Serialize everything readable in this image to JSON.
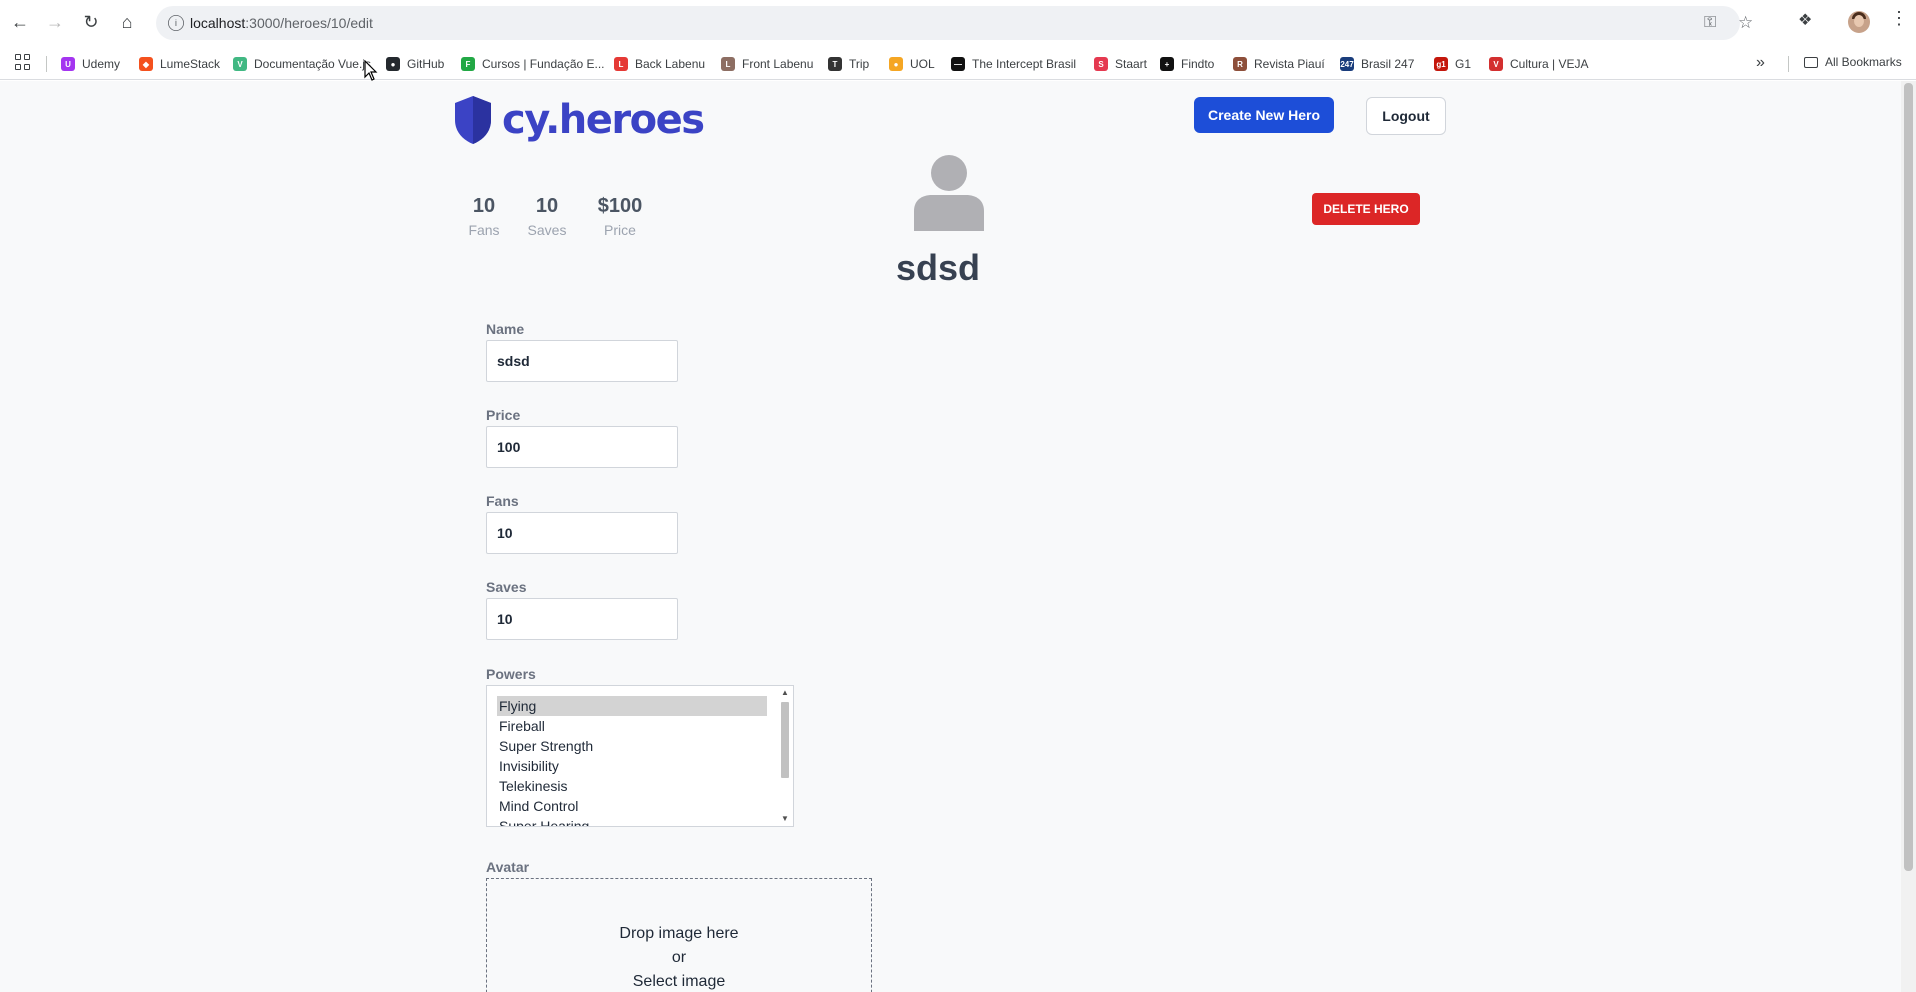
{
  "browser": {
    "url_host": "localhost",
    "url_path": ":3000/heroes/10/edit",
    "bookmarks": [
      {
        "label": "Udemy",
        "color": "#a435f0",
        "glyph": "U"
      },
      {
        "label": "LumeStack",
        "color": "#f4511e",
        "glyph": "◆"
      },
      {
        "label": "Documentação Vue.js",
        "color": "#41b883",
        "glyph": "V"
      },
      {
        "label": "GitHub",
        "color": "#24292e",
        "glyph": "●"
      },
      {
        "label": "Cursos | Fundação E...",
        "color": "#22a845",
        "glyph": "F"
      },
      {
        "label": "Back Labenu",
        "color": "#e53935",
        "glyph": "L"
      },
      {
        "label": "Front Labenu",
        "color": "#8d6e63",
        "glyph": "L"
      },
      {
        "label": "Trip",
        "color": "#333333",
        "glyph": "T"
      },
      {
        "label": "UOL",
        "color": "#f5a623",
        "glyph": "●"
      },
      {
        "label": "The Intercept Brasil",
        "color": "#111111",
        "glyph": "—"
      },
      {
        "label": "Staart",
        "color": "#e53950",
        "glyph": "S"
      },
      {
        "label": "Findto",
        "color": "#111111",
        "glyph": "+"
      },
      {
        "label": "Revista Piauí",
        "color": "#8d4f3a",
        "glyph": "R"
      },
      {
        "label": "Brasil 247",
        "color": "#1a3d7c",
        "glyph": "247"
      },
      {
        "label": "G1",
        "color": "#c4170c",
        "glyph": "g1"
      },
      {
        "label": "Cultura | VEJA",
        "color": "#d32f2f",
        "glyph": "V"
      }
    ],
    "all_bookmarks_label": "All Bookmarks"
  },
  "header": {
    "logo_text": "cy.heroes",
    "create_button": "Create New Hero",
    "logout_button": "Logout"
  },
  "hero": {
    "name": "sdsd",
    "stats": [
      {
        "value": "10",
        "label": "Fans"
      },
      {
        "value": "10",
        "label": "Saves"
      },
      {
        "value": "$100",
        "label": "Price"
      }
    ],
    "delete_button": "DELETE HERO"
  },
  "form": {
    "name": {
      "label": "Name",
      "value": "sdsd"
    },
    "price": {
      "label": "Price",
      "value": "100"
    },
    "fans": {
      "label": "Fans",
      "value": "10"
    },
    "saves": {
      "label": "Saves",
      "value": "10"
    },
    "powers": {
      "label": "Powers",
      "options": [
        "Flying",
        "Fireball",
        "Super Strength",
        "Invisibility",
        "Telekinesis",
        "Mind Control",
        "Super Hearing"
      ],
      "selected": "Flying"
    },
    "avatar": {
      "label": "Avatar",
      "drop_text": "Drop image here",
      "or_text": "or",
      "select_text": "Select image"
    }
  },
  "colors": {
    "brand": "#3b43c5",
    "primary_button": "#1d4ed8",
    "danger_button": "#dc2626"
  }
}
